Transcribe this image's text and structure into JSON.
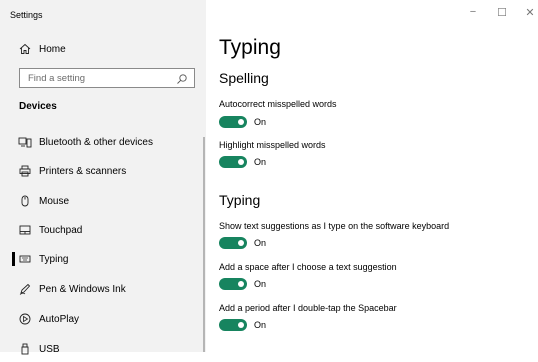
{
  "window": {
    "title": "Settings",
    "controls": {
      "minimize": "−",
      "maximize": "☐",
      "close": "✕"
    }
  },
  "sidebar": {
    "home_label": "Home",
    "search_placeholder": "Find a setting",
    "section_header": "Devices",
    "items": [
      {
        "label": "Bluetooth & other devices",
        "icon": "bluetooth-devices-icon"
      },
      {
        "label": "Printers & scanners",
        "icon": "printer-icon"
      },
      {
        "label": "Mouse",
        "icon": "mouse-icon"
      },
      {
        "label": "Touchpad",
        "icon": "touchpad-icon"
      },
      {
        "label": "Typing",
        "icon": "keyboard-icon",
        "selected": true
      },
      {
        "label": "Pen & Windows Ink",
        "icon": "pen-icon"
      },
      {
        "label": "AutoPlay",
        "icon": "autoplay-icon"
      },
      {
        "label": "USB",
        "icon": "usb-icon"
      }
    ]
  },
  "main": {
    "title": "Typing",
    "spelling": {
      "heading": "Spelling",
      "settings": [
        {
          "label": "Autocorrect misspelled words",
          "state": "On",
          "on": true
        },
        {
          "label": "Highlight misspelled words",
          "state": "On",
          "on": true
        }
      ]
    },
    "typing": {
      "heading": "Typing",
      "settings": [
        {
          "label": "Show text suggestions as I type on the software keyboard",
          "state": "On",
          "on": true
        },
        {
          "label": "Add a space after I choose a text suggestion",
          "state": "On",
          "on": true
        },
        {
          "label": "Add a period after I double-tap the Spacebar",
          "state": "On",
          "on": true
        }
      ]
    }
  },
  "colors": {
    "toggle_on": "#17845f",
    "sidebar_bg": "#f2f2f2"
  }
}
